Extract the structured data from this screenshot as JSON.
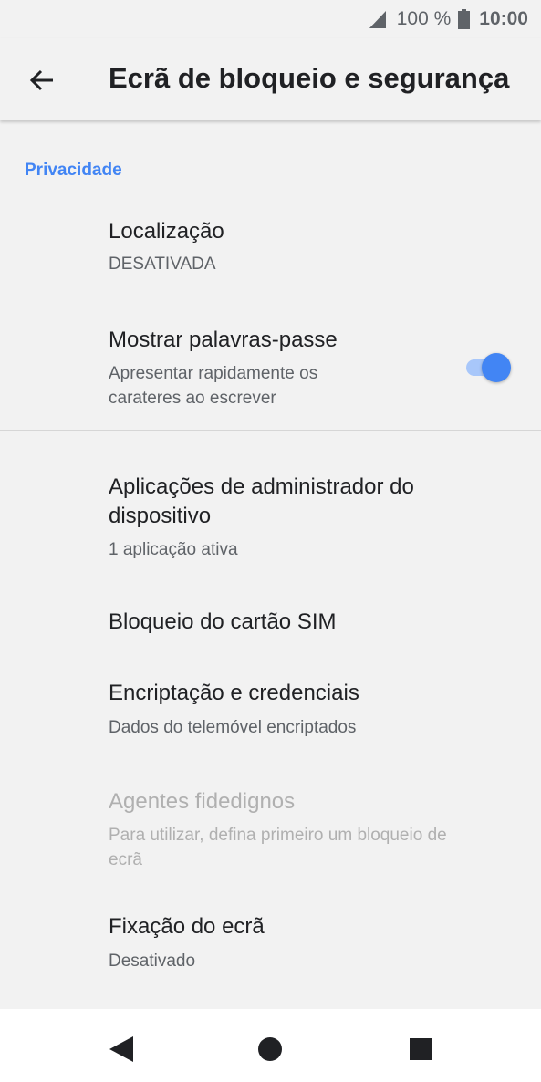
{
  "status_bar": {
    "battery_percent": "100 %",
    "time": "10:00",
    "signal_icon": "signal-icon",
    "battery_icon": "battery-icon"
  },
  "app_bar": {
    "back_icon": "arrow-left-icon",
    "title": "Ecrã de bloqueio e segurança"
  },
  "section": {
    "header": "Privacidade"
  },
  "items": [
    {
      "title": "Localização",
      "summary": "DESATIVADA",
      "enabled": true
    },
    {
      "title": "Mostrar palavras-passe",
      "summary_line1": "Apresentar rapidamente os",
      "summary_line2": "carateres ao escrever",
      "enabled": true,
      "toggle_on": true
    },
    {
      "title_line1": "Aplicações de administrador do",
      "title_line2": "dispositivo",
      "summary": "1 aplicação ativa",
      "enabled": true
    },
    {
      "title": "Bloqueio do cartão SIM",
      "enabled": true
    },
    {
      "title": "Encriptação e credenciais",
      "summary": "Dados do telemóvel encriptados",
      "enabled": true
    },
    {
      "title": "Agentes fidedignos",
      "summary_line1": "Para utilizar, defina primeiro um bloqueio de",
      "summary_line2": "ecrã",
      "enabled": false
    },
    {
      "title": "Fixação do ecrã",
      "summary": "Desativado",
      "enabled": true
    }
  ],
  "colors": {
    "accent": "#4285f4",
    "toggle_track": "#a8c7fa",
    "background": "#f2f2f2",
    "disabled_text": "#b0b0b0"
  },
  "nav_bar": {
    "back_icon": "triangle-back-icon",
    "home_icon": "circle-home-icon",
    "recents_icon": "square-recents-icon"
  }
}
